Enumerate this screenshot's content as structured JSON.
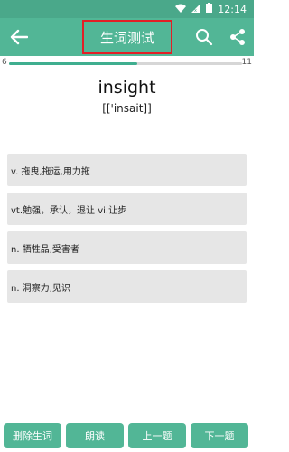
{
  "status_bar": {
    "time": "12:14"
  },
  "app_bar": {
    "title": "生词测试"
  },
  "progress": {
    "current": "6",
    "total": "11",
    "fraction": 0.55
  },
  "question": {
    "word": "insight",
    "phonetic": "[['insait]]"
  },
  "options": [
    {
      "label": "v. 拖曳,拖运,用力拖"
    },
    {
      "label": "vt.勉强，承认，退让 vi.让步"
    },
    {
      "label": "n. 牺牲品,受害者"
    },
    {
      "label": "n. 洞察力,见识"
    }
  ],
  "bottom_buttons": {
    "delete": "删除生词",
    "read": "朗读",
    "prev": "上一题",
    "next": "下一题"
  },
  "colors": {
    "appbar": "#52b696",
    "highlight_border": "#e21f26",
    "option_bg": "#e6e6e6"
  }
}
